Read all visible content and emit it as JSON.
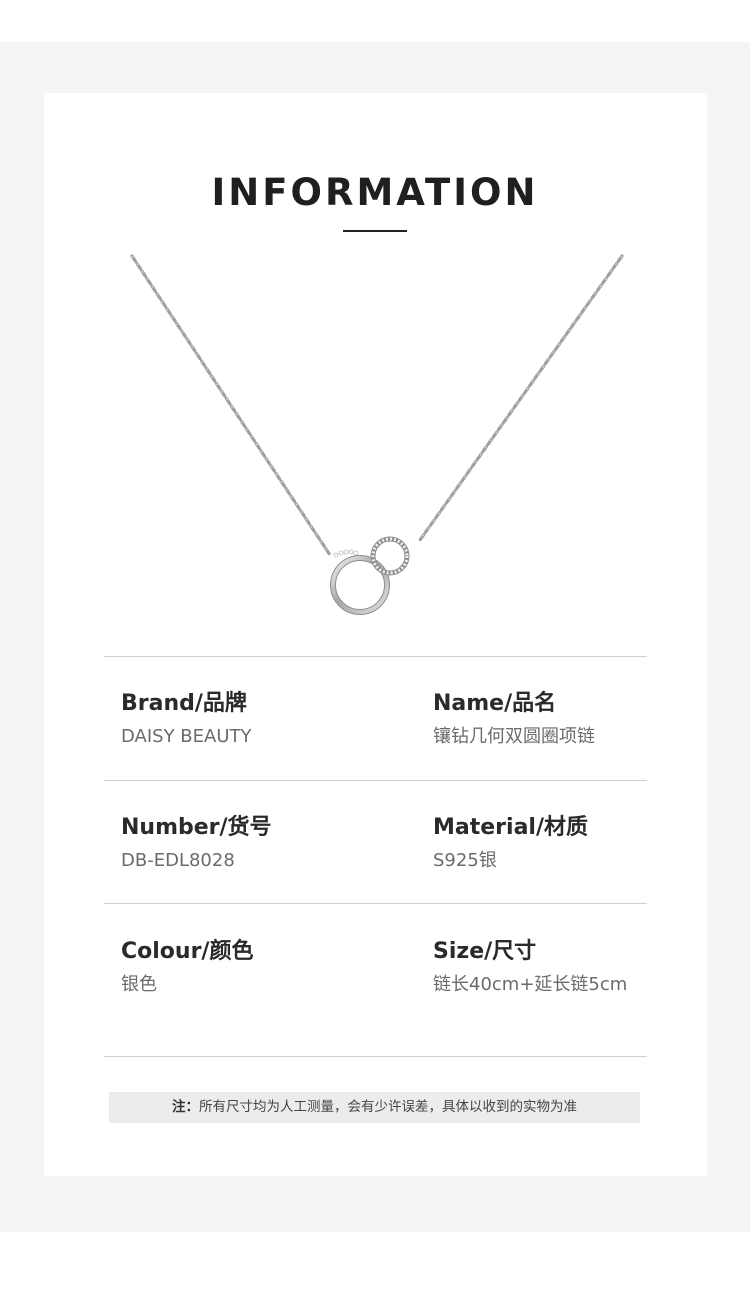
{
  "page": {
    "title": "INFORMATION"
  },
  "specs": {
    "brand_label": "Brand/品牌",
    "brand_value": "DAISY BEAUTY",
    "name_label": "Name/品名",
    "name_value": "镶钻几何双圆圈项链",
    "number_label": "Number/货号",
    "number_value": "DB-EDL8028",
    "material_label": "Material/材质",
    "material_value": "S925银",
    "colour_label": "Colour/颜色",
    "colour_value": "银色",
    "size_label": "Size/尺寸",
    "size_value": "链长40cm+延长链5cm"
  },
  "note": {
    "prefix": "注：",
    "text": "所有尺寸均为人工测量，会有少许误差，具体以收到的实物为准"
  },
  "product_image": {
    "description_icon": "necklace-icon"
  },
  "colors": {
    "page_background": "#f4f4f4",
    "card_background": "#ffffff",
    "title": "#1f1f1f",
    "divider": "#cfcfcf",
    "note_background": "#ececec"
  }
}
